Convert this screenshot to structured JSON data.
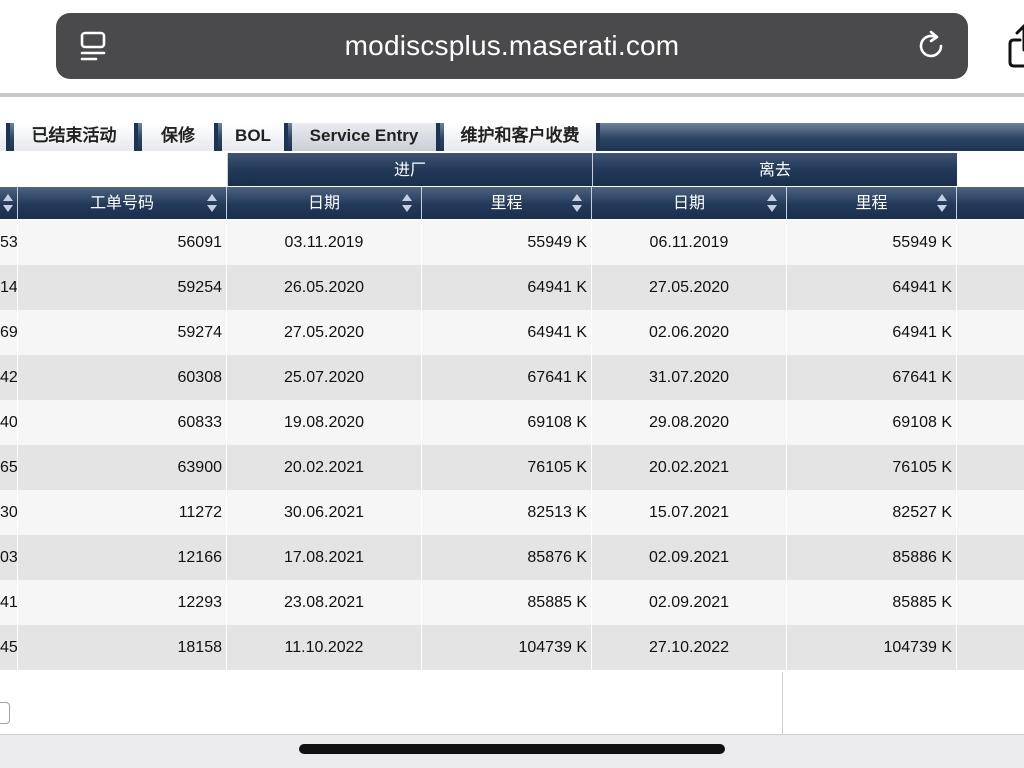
{
  "browser": {
    "url": "modiscsplus.maserati.com"
  },
  "tabs": [
    {
      "label": "已结束活动",
      "active": false
    },
    {
      "label": "保修",
      "active": false
    },
    {
      "label": "BOL",
      "active": false
    },
    {
      "label": "Service Entry",
      "active": true
    },
    {
      "label": "维护和客户收费",
      "active": false
    }
  ],
  "table": {
    "group_headers": {
      "entry": "进厂",
      "leave": "离去"
    },
    "columns": {
      "work_order": "工单号码",
      "entry_date": "日期",
      "entry_mileage": "里程",
      "leave_date": "日期",
      "leave_mileage": "里程"
    },
    "rows": [
      {
        "prev": "53",
        "work_order": "56091",
        "entry_date": "03.11.2019",
        "entry_mileage": "55949 K",
        "leave_date": "06.11.2019",
        "leave_mileage": "55949 K"
      },
      {
        "prev": "14",
        "work_order": "59254",
        "entry_date": "26.05.2020",
        "entry_mileage": "64941 K",
        "leave_date": "27.05.2020",
        "leave_mileage": "64941 K"
      },
      {
        "prev": "69",
        "work_order": "59274",
        "entry_date": "27.05.2020",
        "entry_mileage": "64941 K",
        "leave_date": "02.06.2020",
        "leave_mileage": "64941 K"
      },
      {
        "prev": "42",
        "work_order": "60308",
        "entry_date": "25.07.2020",
        "entry_mileage": "67641 K",
        "leave_date": "31.07.2020",
        "leave_mileage": "67641 K"
      },
      {
        "prev": "40",
        "work_order": "60833",
        "entry_date": "19.08.2020",
        "entry_mileage": "69108 K",
        "leave_date": "29.08.2020",
        "leave_mileage": "69108 K"
      },
      {
        "prev": "65",
        "work_order": "63900",
        "entry_date": "20.02.2021",
        "entry_mileage": "76105 K",
        "leave_date": "20.02.2021",
        "leave_mileage": "76105 K"
      },
      {
        "prev": "30",
        "work_order": "11272",
        "entry_date": "30.06.2021",
        "entry_mileage": "82513 K",
        "leave_date": "15.07.2021",
        "leave_mileage": "82527 K"
      },
      {
        "prev": "03",
        "work_order": "12166",
        "entry_date": "17.08.2021",
        "entry_mileage": "85876 K",
        "leave_date": "02.09.2021",
        "leave_mileage": "85886 K"
      },
      {
        "prev": "41",
        "work_order": "12293",
        "entry_date": "23.08.2021",
        "entry_mileage": "85885 K",
        "leave_date": "02.09.2021",
        "leave_mileage": "85885 K"
      },
      {
        "prev": "45",
        "work_order": "18158",
        "entry_date": "11.10.2022",
        "entry_mileage": "104739 K",
        "leave_date": "27.10.2022",
        "leave_mileage": "104739 K"
      }
    ]
  },
  "icons": {
    "tabs": "tabs-icon",
    "reload": "reload-icon",
    "share": "share-icon",
    "sort": "sort-arrows-icon"
  },
  "colors": {
    "header_navy": "#22395a",
    "url_bar": "#4a4a4c",
    "row_light": "#f6f6f6",
    "row_dark": "#e4e4e4"
  }
}
